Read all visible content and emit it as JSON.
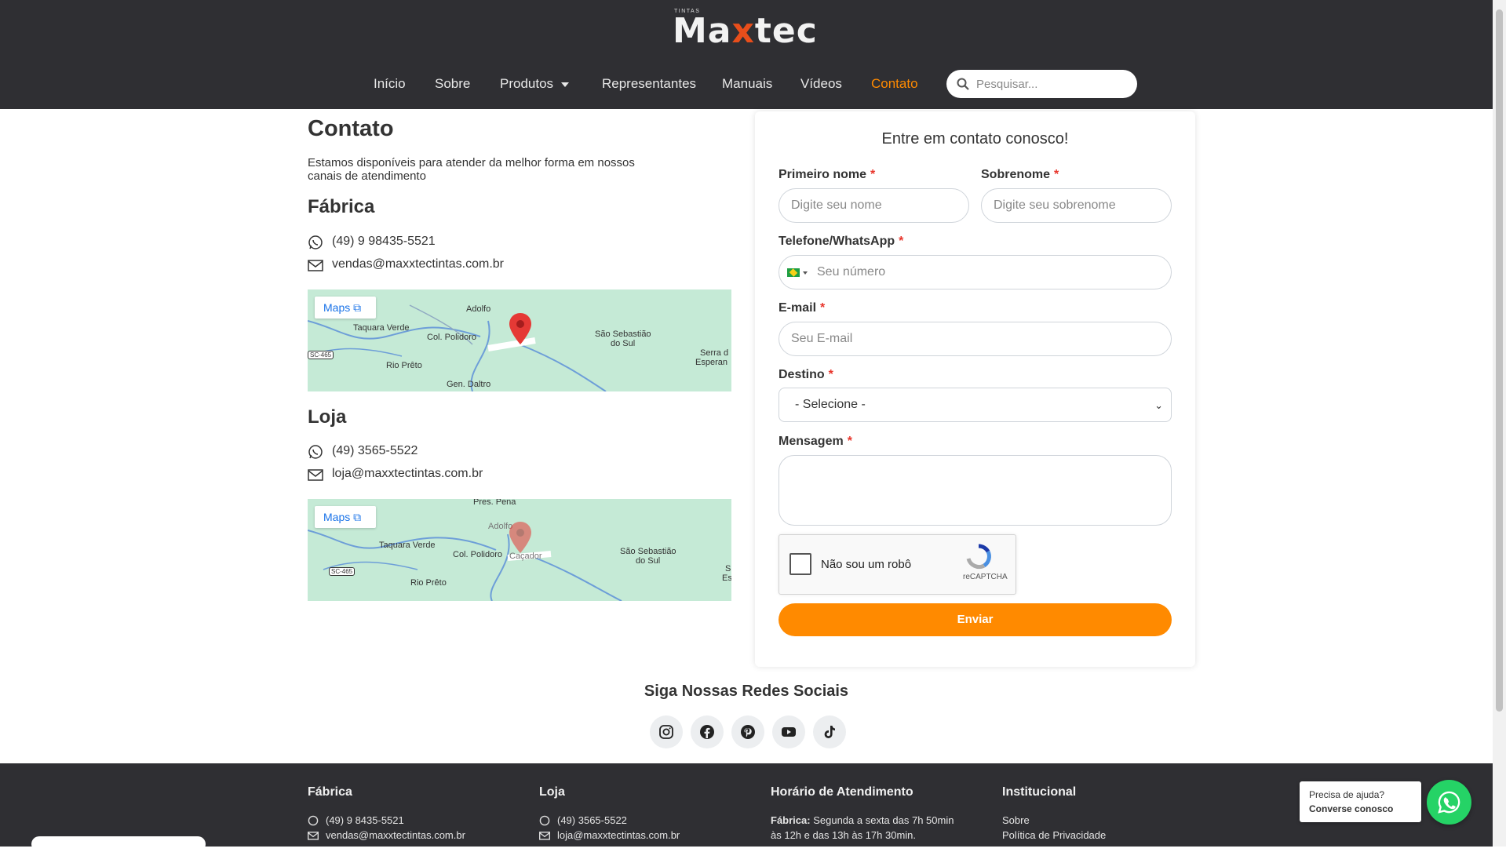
{
  "header": {
    "logo_small": "TINTAS",
    "logo_prefix": "Ma",
    "logo_x": "x",
    "logo_suffix": "tec",
    "nav": [
      {
        "label": "Início"
      },
      {
        "label": "Sobre"
      },
      {
        "label": "Produtos"
      },
      {
        "label": "Representantes"
      },
      {
        "label": "Manuais"
      },
      {
        "label": "Vídeos"
      },
      {
        "label": "Contato"
      }
    ],
    "search_placeholder": "Pesquisar..."
  },
  "contact": {
    "title": "Contato",
    "intro": "Estamos disponíveis para atender da melhor forma em nossos canais de atendimento",
    "factory": {
      "heading": "Fábrica",
      "phone": "(49) 9 98435-5521",
      "email": "vendas@maxxtectintas.com.br",
      "map_button": "Maps",
      "map_labels": [
        "Adolfo",
        "Taquara Verde",
        "Col. Polidoro",
        "São Sebastião",
        "do Sul",
        "SC-465",
        "Rio Prêto",
        "Serra d",
        "Esperan",
        "Gen. Daltro"
      ]
    },
    "store": {
      "heading": "Loja",
      "phone": "(49) 3565-5522",
      "email": "loja@maxxtectintas.com.br",
      "map_button": "Maps",
      "map_labels": [
        "Pres. Pena",
        "Adolfo",
        "Taquara Verde",
        "Col. Polidoro",
        "Caçador",
        "São Sebastião",
        "do Sul",
        "SC-465",
        "Rio Prêto",
        "S",
        "Es"
      ]
    }
  },
  "form": {
    "title": "Entre em contato conosco!",
    "first_name_label": "Primeiro nome",
    "first_name_placeholder": "Digite seu nome",
    "last_name_label": "Sobrenome",
    "last_name_placeholder": "Digite seu sobrenome",
    "phone_label": "Telefone/WhatsApp",
    "phone_placeholder": "Seu número",
    "email_label": "E-mail",
    "email_placeholder": "Seu E-mail",
    "dest_label": "Destino",
    "dest_value": "- Selecione -",
    "message_label": "Mensagem",
    "required_mark": "*",
    "captcha_text": "Não sou um robô",
    "captcha_brand": "reCAPTCHA",
    "submit": "Enviar"
  },
  "social": {
    "title": "Siga Nossas Redes Sociais",
    "icons": [
      "instagram-icon",
      "facebook-icon",
      "pinterest-icon",
      "youtube-icon",
      "tiktok-icon"
    ]
  },
  "footer": {
    "factory": {
      "heading": "Fábrica",
      "phone": "(49) 9 8435-5521",
      "email": "vendas@maxxtectintas.com.br"
    },
    "store": {
      "heading": "Loja",
      "phone": "(49) 3565-5522",
      "email": "loja@maxxtectintas.com.br"
    },
    "hours": {
      "heading": "Horário de Atendimento",
      "label": "Fábrica:",
      "line1": "Segunda a sexta das 7h 50min",
      "line2": "às 12h e das 13h às 17h 30min."
    },
    "institutional": {
      "heading": "Institucional",
      "links": [
        "Sobre",
        "Política de Privacidade"
      ]
    }
  },
  "whatsapp_widget": {
    "line1": "Precisa de ajuda?",
    "line2": "Converse conosco"
  },
  "colors": {
    "header_bg": "#2f2f33",
    "accent": "#ff8a00",
    "whatsapp": "#25d366"
  }
}
